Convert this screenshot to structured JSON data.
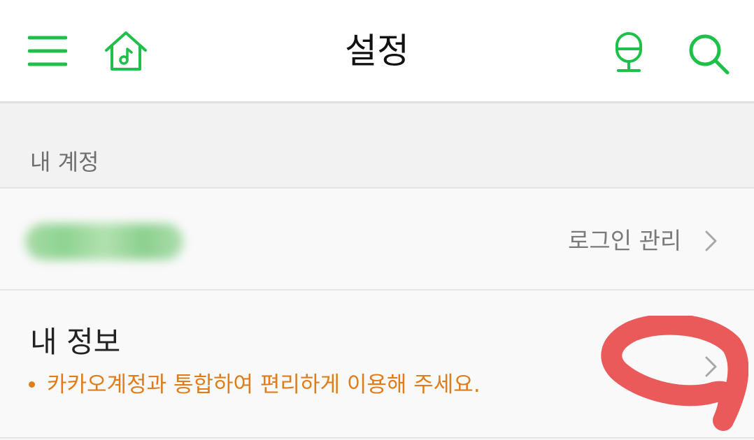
{
  "header": {
    "title": "설정",
    "icons": [
      "menu-icon",
      "music-home-icon",
      "microphone-icon",
      "search-icon"
    ]
  },
  "colors": {
    "accent": "#1ec04a",
    "note": "#e07d1a",
    "annotation": "#ea5a5a"
  },
  "section": {
    "label": "내 계정"
  },
  "account_row": {
    "login_manage_label": "로그인 관리"
  },
  "info_row": {
    "title": "내 정보",
    "note": "카카오계정과 통합하여 편리하게 이용해 주세요."
  }
}
